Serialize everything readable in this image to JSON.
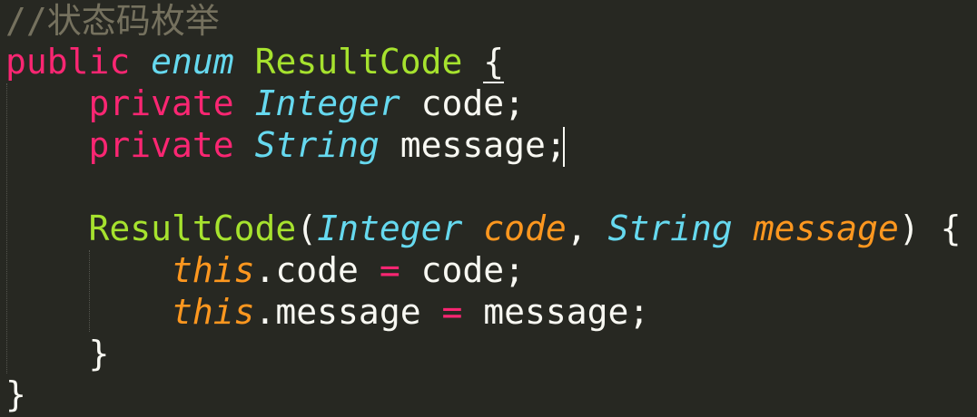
{
  "editor": {
    "theme": "monokai",
    "colors": {
      "background": "#272822",
      "comment": "#75715e",
      "keyword": "#f92672",
      "type": "#66d9ef",
      "class_name": "#a6e22e",
      "parameter": "#fd971f",
      "plain": "#f8f8f2"
    },
    "lines": [
      {
        "comment": "//状态码枚举"
      },
      {
        "kw_public": "public",
        "kw_enum": "enum",
        "class_name": "ResultCode",
        "brace": "{"
      },
      {
        "kw": "private",
        "type": "Integer",
        "name": "code",
        "semi": ";"
      },
      {
        "kw": "private",
        "type": "String",
        "name": "message",
        "semi": ";"
      },
      {},
      {
        "ctor": "ResultCode",
        "lparen": "(",
        "type1": "Integer",
        "param1": "code",
        "comma": ",",
        "type2": "String",
        "param2": "message",
        "rparen": ")",
        "brace": "{"
      },
      {
        "this": "this",
        "dot_field": ".code",
        "op": "=",
        "value": "code",
        "semi": ";"
      },
      {
        "this": "this",
        "dot_field": ".message",
        "op": "=",
        "value": "message",
        "semi": ";"
      },
      {
        "brace": "}"
      },
      {
        "brace": "}"
      }
    ]
  }
}
